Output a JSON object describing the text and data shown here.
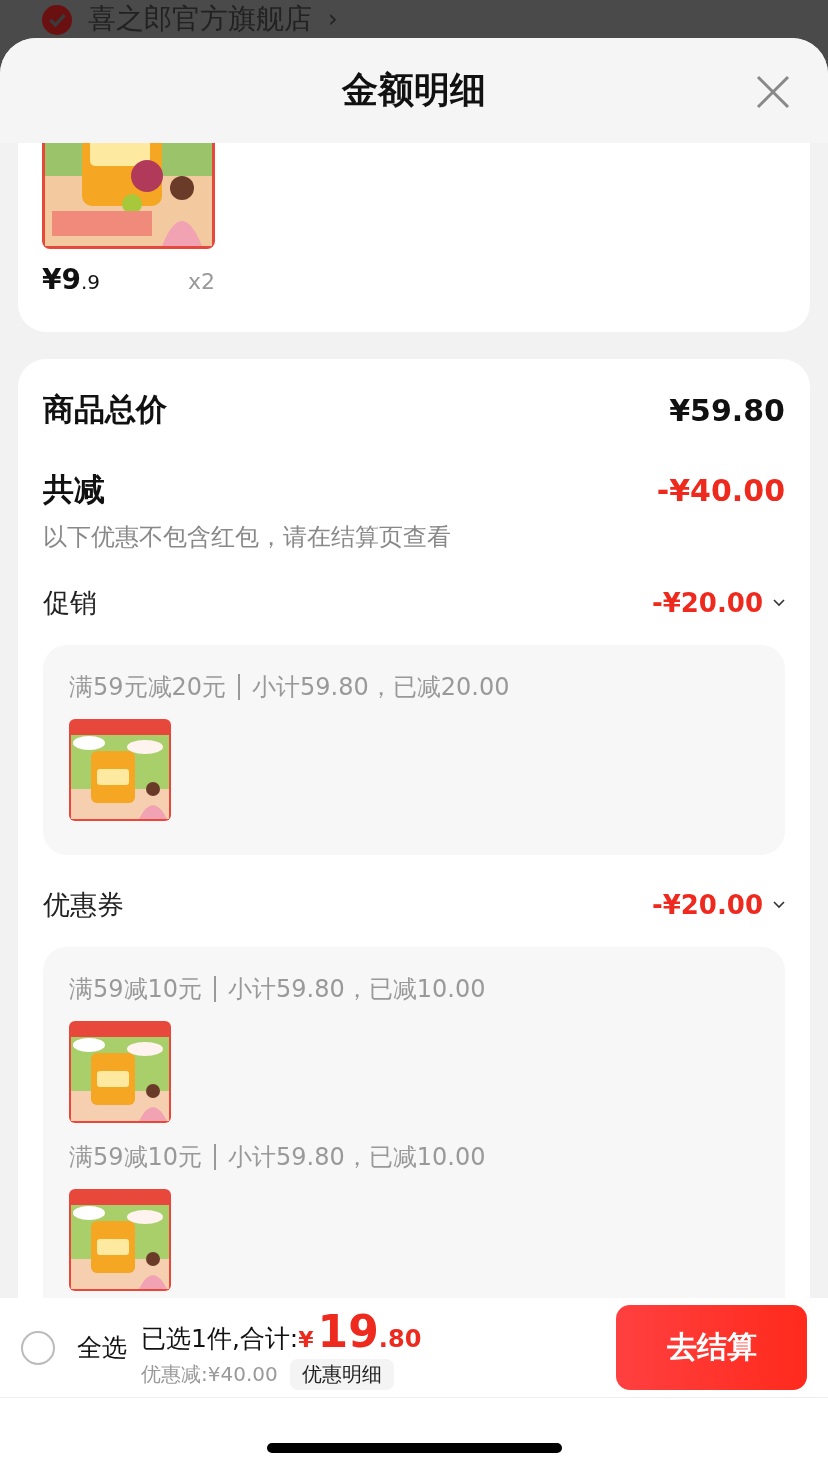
{
  "store": {
    "name": "喜之郎官方旗舰店",
    "chevron": "›",
    "verified": true
  },
  "sheet": {
    "title": "金额明细"
  },
  "item": {
    "price_int": "¥9",
    "price_dec": ".9",
    "quantity": "x2"
  },
  "summary": {
    "total_label": "商品总价",
    "total": "¥59.80",
    "reduce_label": "共减",
    "reduce": "-¥40.00",
    "note": "以下优惠不包含红包，请在结算页查看"
  },
  "sections": [
    {
      "title": "促销",
      "amount": "-¥20.00",
      "expanded": true,
      "groups": [
        {
          "rule": "满59元减20元",
          "subtotal": "小计59.80，已减20.00"
        }
      ]
    },
    {
      "title": "优惠券",
      "amount": "-¥20.00",
      "expanded": true,
      "groups": [
        {
          "rule": "满59减10元",
          "subtotal": "小计59.80，已减10.00"
        },
        {
          "rule": "满59减10元",
          "subtotal": "小计59.80，已减10.00"
        }
      ]
    }
  ],
  "footer": {
    "select_all": {
      "label": "全选",
      "checked": false
    },
    "selected": "已选1件,合计:",
    "currency": "¥",
    "total_int": "19",
    "total_dec": ".80",
    "discount": "优惠减:¥40.00",
    "detail_button": "优惠明细",
    "checkout_button": "去结算"
  }
}
